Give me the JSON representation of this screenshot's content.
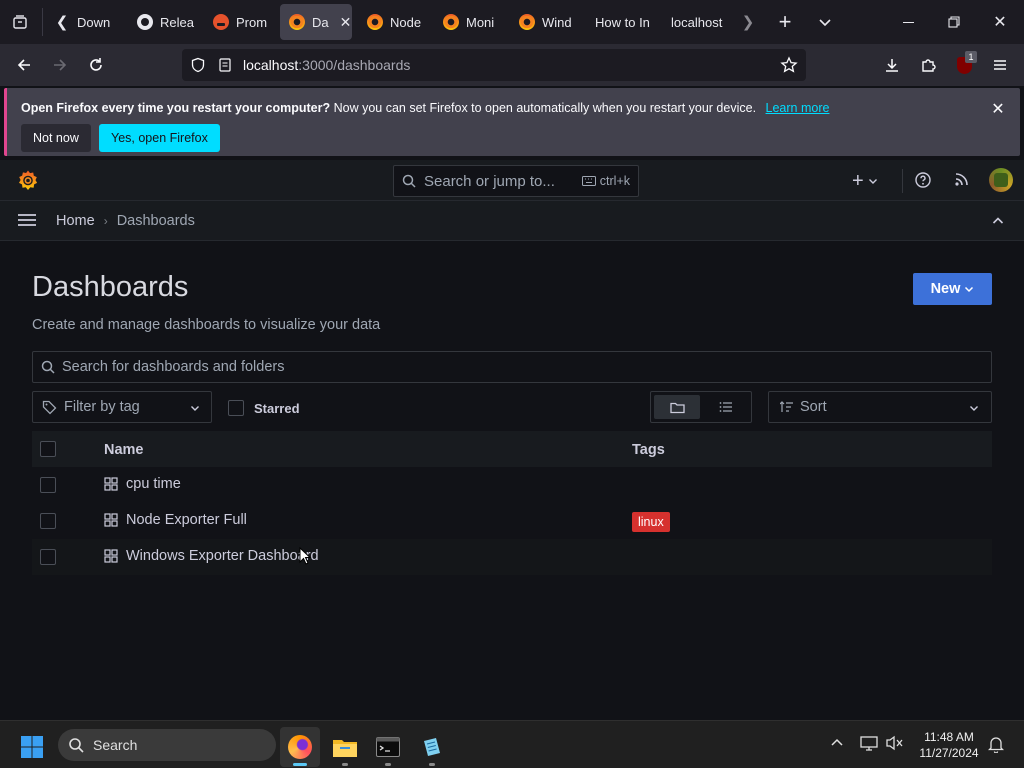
{
  "browser": {
    "tabs": [
      {
        "label": "Down",
        "icon": "download-favicon"
      },
      {
        "label": "Relea",
        "icon": "github-favicon"
      },
      {
        "label": "Prom",
        "icon": "prometheus-favicon"
      },
      {
        "label": "Da",
        "icon": "grafana-favicon",
        "active": true
      },
      {
        "label": "Node",
        "icon": "grafana-favicon"
      },
      {
        "label": "Moni",
        "icon": "grafana-favicon"
      },
      {
        "label": "Wind",
        "icon": "grafana-favicon"
      },
      {
        "label": "How to In",
        "icon": ""
      },
      {
        "label": "localhost",
        "icon": ""
      }
    ],
    "url_host": "localhost",
    "url_path": ":3000/dashboards",
    "extension_badge": "1"
  },
  "notification": {
    "bold": "Open Firefox every time you restart your computer?",
    "text": "Now you can set Firefox to open automatically when you restart your device.",
    "link": "Learn more",
    "not_now": "Not now",
    "yes": "Yes, open Firefox"
  },
  "grafana": {
    "search_placeholder": "Search or jump to...",
    "search_shortcut": "ctrl+k",
    "breadcrumb": [
      "Home",
      "Dashboards"
    ],
    "page_title": "Dashboards",
    "page_subtitle": "Create and manage dashboards to visualize your data",
    "new_button": "New",
    "search_dashboards_placeholder": "Search for dashboards and folders",
    "filter_tag_placeholder": "Filter by tag",
    "starred_label": "Starred",
    "sort_label": "Sort",
    "table_headers": {
      "name": "Name",
      "tags": "Tags"
    },
    "rows": [
      {
        "name": "cpu time",
        "tag": ""
      },
      {
        "name": "Node Exporter Full",
        "tag": "linux"
      },
      {
        "name": "Windows Exporter Dashboard",
        "tag": ""
      }
    ]
  },
  "taskbar": {
    "search_label": "Search",
    "time": "11:48 AM",
    "date": "11/27/2024"
  },
  "colors": {
    "primary": "#3d71d9",
    "tag_linux": "#d6312e",
    "firefox_cyan": "#00ddff"
  }
}
